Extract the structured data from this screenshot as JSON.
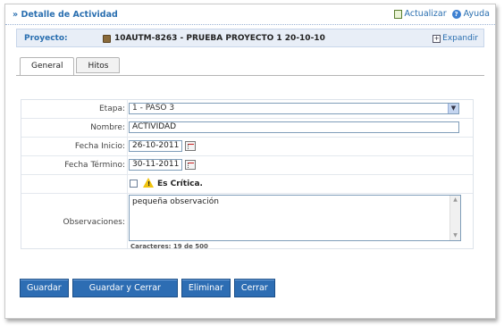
{
  "header": {
    "title": "» Detalle de Actividad",
    "refresh_label": "Actualizar",
    "help_label": "Ayuda"
  },
  "project": {
    "label": "Proyecto:",
    "value": "10AUTM-8263 - PRUEBA PROYECTO 1 20-10-10",
    "expand_label": "Expandir"
  },
  "tabs": [
    {
      "label": "General",
      "active": true
    },
    {
      "label": "Hitos",
      "active": false
    }
  ],
  "form": {
    "etapa_label": "Etapa:",
    "etapa_value": "1 - PASO 3",
    "nombre_label": "Nombre:",
    "nombre_value": "ACTIVIDAD",
    "fecha_inicio_label": "Fecha Inicio:",
    "fecha_inicio_value": "26-10-2011",
    "fecha_termino_label": "Fecha Término:",
    "fecha_termino_value": "30-11-2011",
    "critica_label": "Es Crítica.",
    "critica_checked": false,
    "observaciones_label": "Observaciones:",
    "observaciones_value": "pequeña observación",
    "counter_text": "Caracteres: 19 de 500"
  },
  "buttons": {
    "save": "Guardar",
    "save_close": "Guardar y Cerrar",
    "delete": "Eliminar",
    "close": "Cerrar"
  },
  "colors": {
    "accent": "#2a6fb0",
    "button": "#2d6db3"
  }
}
